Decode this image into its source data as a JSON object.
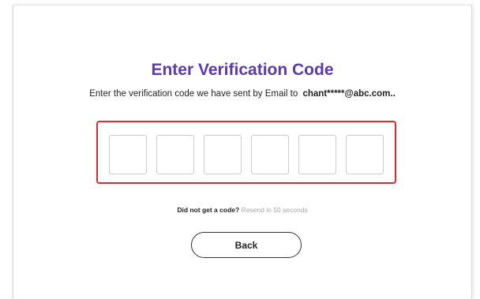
{
  "page": {
    "title": "Enter Verification Code",
    "instruction": "Enter the verification code we have sent by Email to",
    "email": "chant*****@abc.com.."
  },
  "code_inputs": [
    {
      "value": ""
    },
    {
      "value": ""
    },
    {
      "value": ""
    },
    {
      "value": ""
    },
    {
      "value": ""
    },
    {
      "value": ""
    }
  ],
  "resend": {
    "question": "Did not get a code?",
    "countdown": "Resend in 50 seconds"
  },
  "actions": {
    "back_label": "Back"
  },
  "colors": {
    "title": "#5b3ab0",
    "highlight_border": "#e0282d",
    "muted_text": "#a8a8a8"
  }
}
